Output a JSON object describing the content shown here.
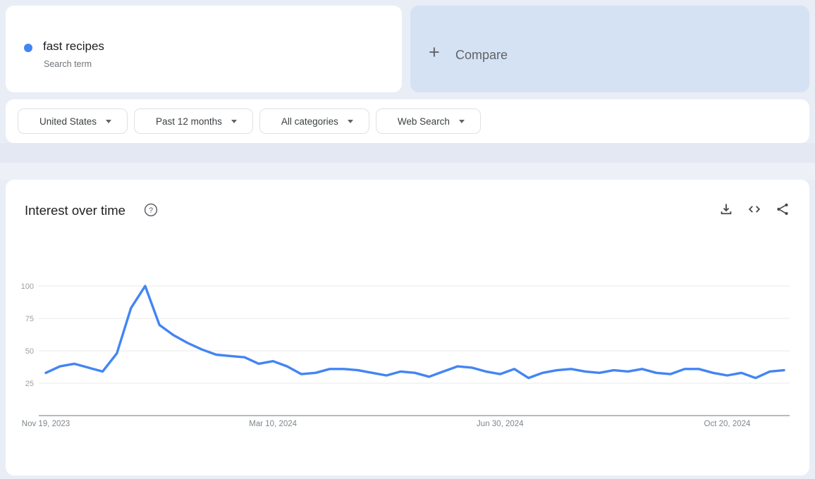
{
  "search_card": {
    "term": "fast recipes",
    "subtitle": "Search term",
    "dot_color": "#4285f4"
  },
  "compare_card": {
    "plus": "+",
    "label": "Compare"
  },
  "filters": [
    {
      "label": "United States"
    },
    {
      "label": "Past 12 months"
    },
    {
      "label": "All categories"
    },
    {
      "label": "Web Search"
    }
  ],
  "panel": {
    "title": "Interest over time",
    "help": "?"
  },
  "colors": {
    "accent_blue": "#4285f4",
    "compare_bg": "#d5e2f3",
    "gridline": "#e8e8e8",
    "axis_line": "#70757a",
    "tick_text": "#9aa0a6"
  },
  "chart_data": {
    "type": "line",
    "title": "Interest over time",
    "x_unit": "week",
    "x_tick_labels": [
      "Nov 19, 2023",
      "Mar 10, 2024",
      "Jun 30, 2024",
      "Oct 20, 2024"
    ],
    "x_tick_indices": [
      0,
      16,
      32,
      48
    ],
    "y_ticks": [
      25,
      50,
      75,
      100
    ],
    "ylim": [
      0,
      100
    ],
    "grid": "horizontal",
    "legend": "none",
    "series": [
      {
        "name": "fast recipes",
        "color": "#4285f4",
        "values": [
          33,
          38,
          40,
          37,
          34,
          48,
          83,
          100,
          70,
          62,
          56,
          51,
          47,
          46,
          45,
          40,
          42,
          38,
          32,
          33,
          36,
          36,
          35,
          33,
          31,
          34,
          33,
          30,
          34,
          38,
          37,
          34,
          32,
          36,
          29,
          33,
          35,
          36,
          34,
          33,
          35,
          34,
          36,
          33,
          32,
          36,
          36,
          33,
          31,
          33,
          29,
          34,
          35
        ]
      }
    ]
  }
}
